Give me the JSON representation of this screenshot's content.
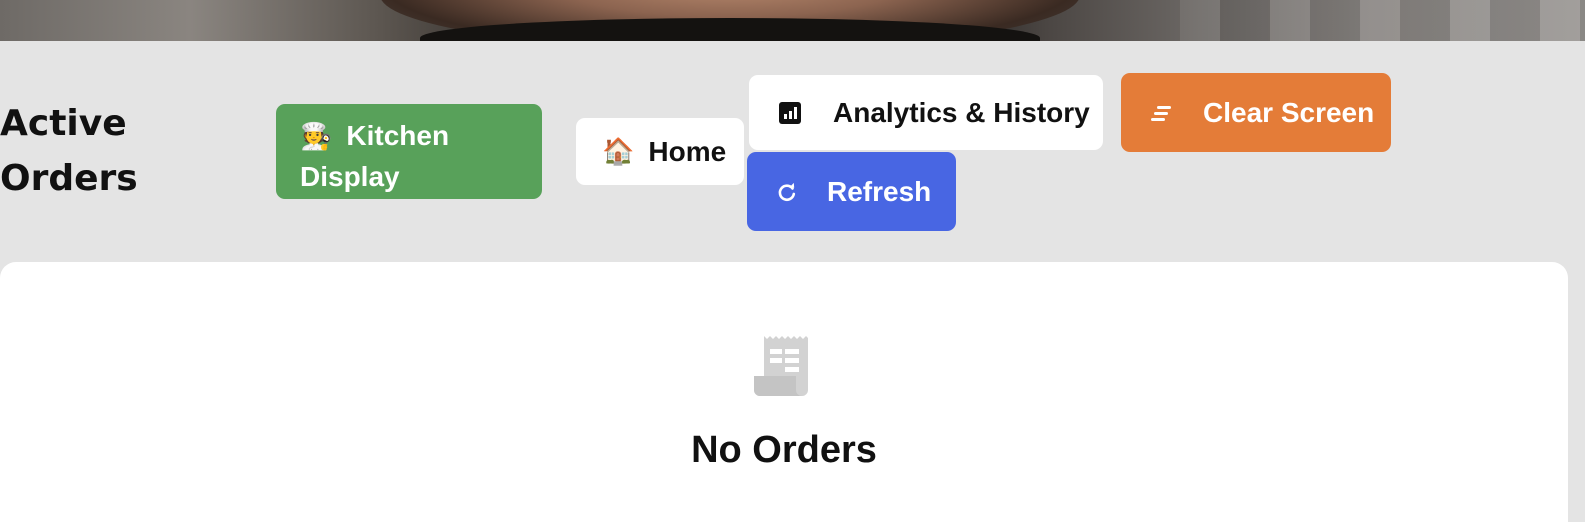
{
  "header": {
    "title": "Active Orders"
  },
  "toolbar": {
    "kitchen_display": {
      "emoji": "🧑‍🍳",
      "label": "Kitchen Display",
      "color": "#58a15a"
    },
    "home": {
      "emoji": "🏠",
      "label": "Home",
      "color": "#ffffff"
    },
    "analytics": {
      "icon": "bar-chart-icon",
      "label": "Analytics & History",
      "color": "#ffffff"
    },
    "clear_screen": {
      "icon": "clear-lines-icon",
      "label": "Clear Screen",
      "color": "#e47c38"
    },
    "refresh": {
      "icon": "refresh-icon",
      "label": "Refresh",
      "color": "#4866e3"
    }
  },
  "empty_state": {
    "icon": "receipt-icon",
    "title": "No Orders"
  }
}
